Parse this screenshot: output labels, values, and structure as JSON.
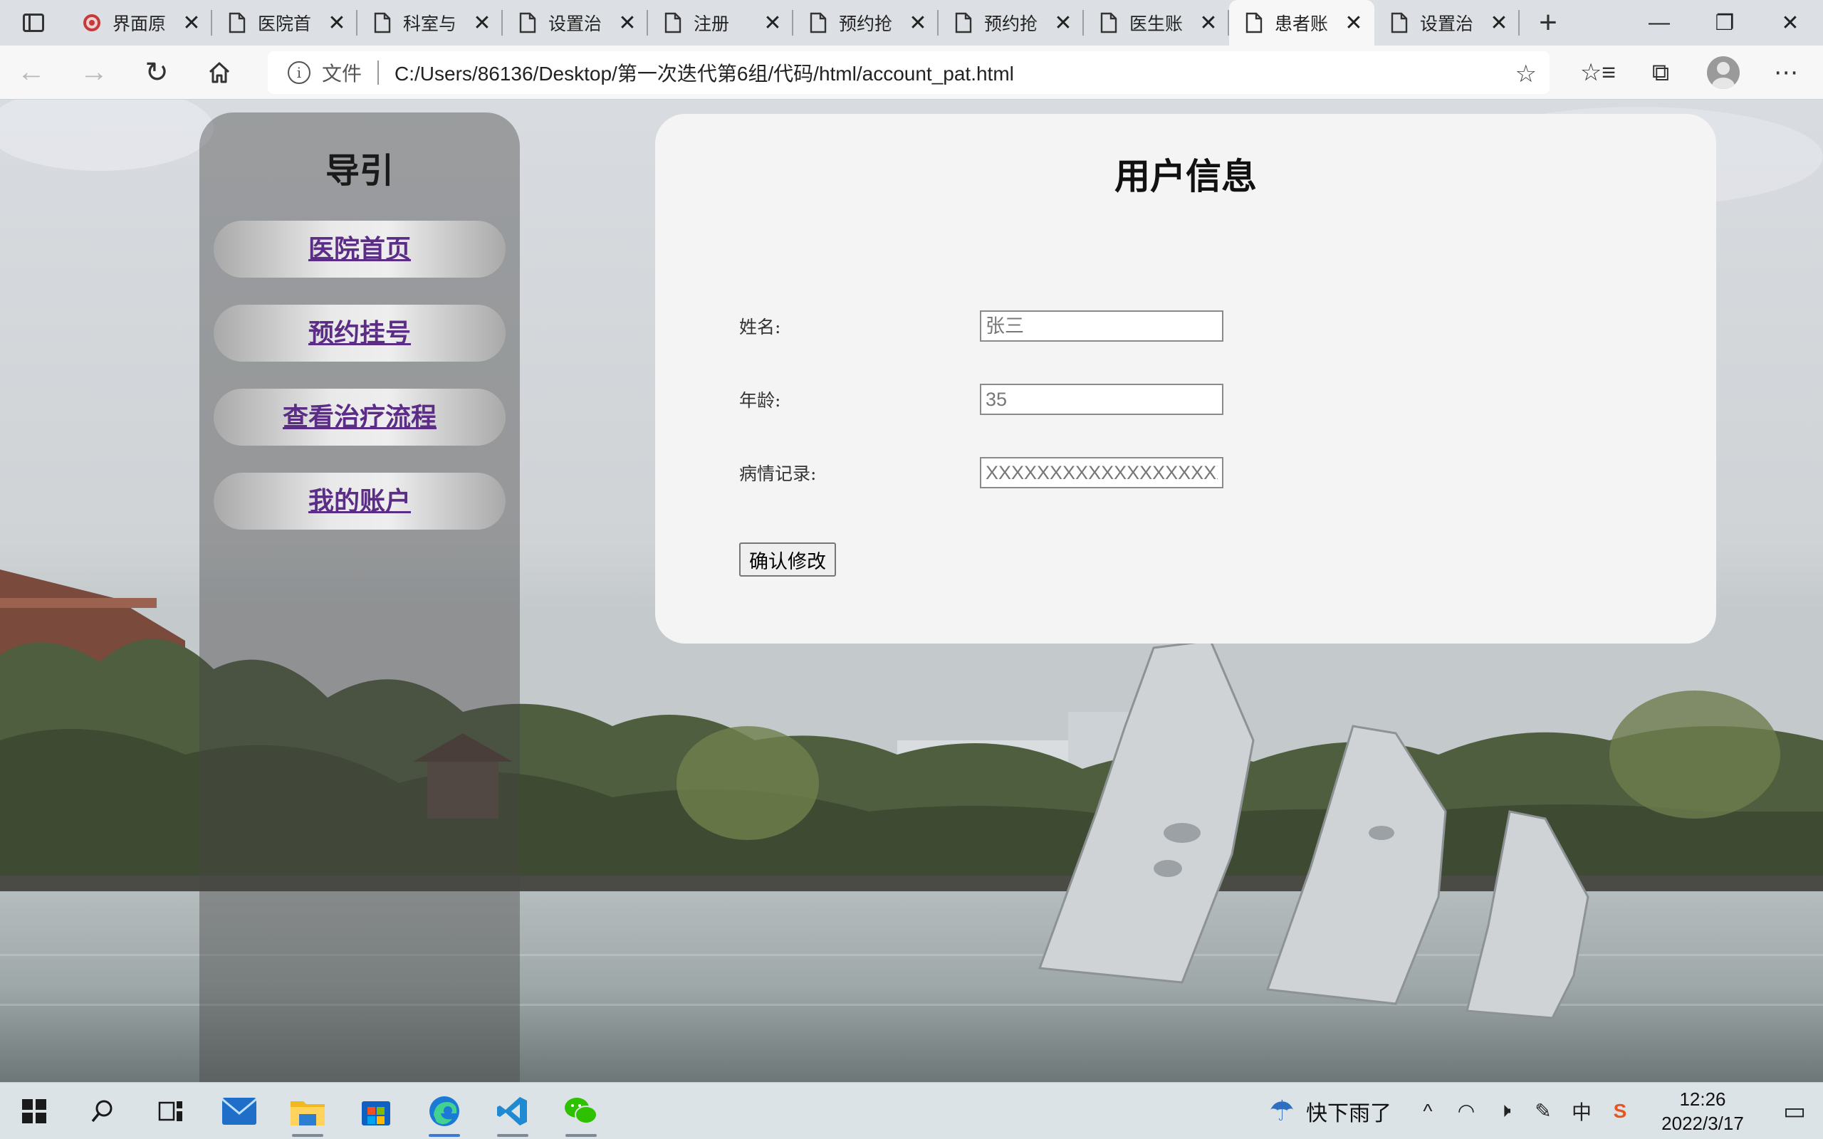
{
  "browser": {
    "tabs": [
      {
        "title": "界面原",
        "icon": "site-logo-icon"
      },
      {
        "title": "医院首",
        "icon": "file-icon"
      },
      {
        "title": "科室与",
        "icon": "file-icon"
      },
      {
        "title": "设置治",
        "icon": "file-icon"
      },
      {
        "title": "注册",
        "icon": "file-icon"
      },
      {
        "title": "预约抢",
        "icon": "file-icon"
      },
      {
        "title": "预约抢",
        "icon": "file-icon"
      },
      {
        "title": "医生账",
        "icon": "file-icon"
      },
      {
        "title": "患者账",
        "icon": "file-icon",
        "active": true
      },
      {
        "title": "设置治",
        "icon": "file-icon"
      }
    ],
    "address": {
      "scheme_label": "文件",
      "url": "C:/Users/86136/Desktop/第一次迭代第6组/代码/html/account_pat.html"
    }
  },
  "sidebar": {
    "title": "导引",
    "items": [
      {
        "label": "医院首页"
      },
      {
        "label": "预约挂号"
      },
      {
        "label": "查看治疗流程"
      },
      {
        "label": "我的账户"
      }
    ],
    "link_color": "#5b2d86"
  },
  "card": {
    "title": "用户信息",
    "fields": [
      {
        "label": "姓名:",
        "placeholder": "张三"
      },
      {
        "label": "年龄:",
        "placeholder": "35"
      },
      {
        "label": "病情记录:",
        "placeholder": "XXXXXXXXXXXXXXXXXXXX"
      }
    ],
    "submit_label": "确认修改"
  },
  "taskbar": {
    "weather": "快下雨了",
    "ime": "中",
    "time": "12:26",
    "date": "2022/3/17"
  }
}
